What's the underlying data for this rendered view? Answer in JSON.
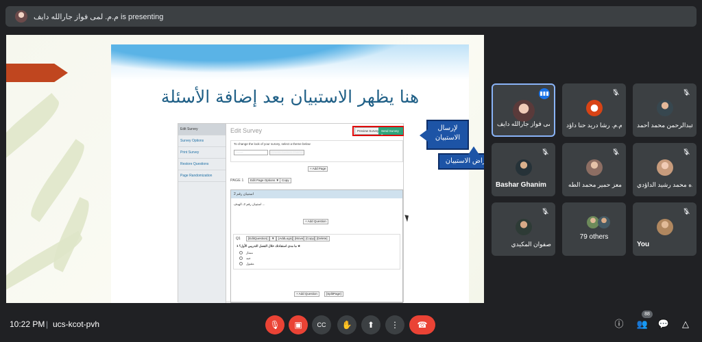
{
  "top_bar": {
    "presenter_text": "م.م. لمى فواز جارالله دايف is presenting"
  },
  "slide": {
    "title": "هنا يظهر الاستبيان بعد إضافة الأسئلة",
    "callout_send": "لإرسال الاستبيان",
    "callout_preview": "لاستعراض الاستبيان",
    "survey": {
      "sidebar_items": [
        "Edit Survey",
        "Survey Options",
        "Print Survey",
        "Restore Questions",
        "Page Randomization"
      ],
      "heading": "Edit Survey",
      "preview_button": "Preview Survey",
      "send_button": "Send Survey »",
      "theme_text": "To change the look of your survey, select a theme below",
      "theme_value": "Aqua",
      "create_theme_button": "Create Custom Theme",
      "add_page_button": "+ Add Page",
      "page_label": "PAGE 1",
      "page_options_button": "Edit Page Options ▼",
      "copy_button": "Copy",
      "page_head": "استبيان رقم 2",
      "page_sub": "استبيان رقم 2، الهدف ...",
      "add_question_button": "+ Add Question",
      "q_number": "Q1",
      "q_tools": [
        "[EditQuestion]",
        "▼",
        "[AddLogic]",
        "[Move]",
        "[Copy]",
        "[Delete]"
      ],
      "q_text": "ما مدى استفادتك خلال الفصل التدريبي الأول؟ 1 ★",
      "q_options": [
        "ممتاز",
        "جيد",
        "مقبول"
      ],
      "add_question_button2": "+ Add Question",
      "split_page_button": "[SplitPage]"
    }
  },
  "participants": [
    {
      "name": "م.م. لمى فواز جارالله دايف ...",
      "active": true,
      "muted": false
    },
    {
      "name": "م.م. رشا دريد حنا داؤد",
      "muted": true
    },
    {
      "name": "عبدالرحمن محمد أحمد",
      "muted": true
    },
    {
      "name": "Bashar Ghanim",
      "muted": true
    },
    {
      "name": "معز حمير محمد الطه",
      "muted": true
    },
    {
      "name": "رعده محمد رشيد الداؤدي",
      "muted": true
    },
    {
      "name": "صفوان المكيدي",
      "muted": true
    },
    {
      "name": "79 others",
      "muted": false
    },
    {
      "name": "You",
      "muted": true
    }
  ],
  "bottom_bar": {
    "time": "10:22 PM",
    "separator": "|",
    "meeting_code": "ucs-kcot-pvh",
    "people_count": "88"
  },
  "icons": {
    "mic": "mic-off-icon",
    "camera": "camera-off-icon",
    "captions": "captions-icon",
    "hand": "raise-hand-icon",
    "present": "present-icon",
    "more": "more-vert-icon",
    "end": "end-call-icon",
    "info": "info-icon",
    "people": "people-icon",
    "chat": "chat-icon",
    "activities": "activities-icon"
  },
  "colors": {
    "end_call": "#ea4335",
    "active_speaker": "#8ab4f8",
    "background": "#202124"
  }
}
